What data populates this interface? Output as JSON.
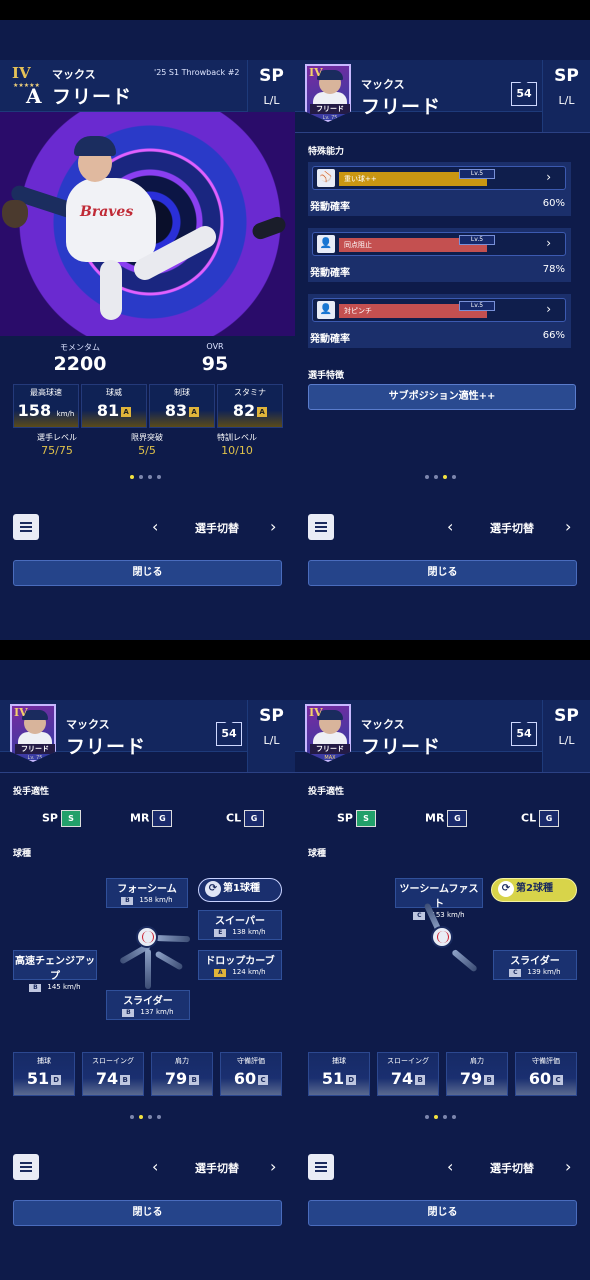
{
  "player": {
    "kana": "マックス",
    "name": "フリード",
    "card_series": "'25 S1 Throwback #2",
    "rank": "IV",
    "team_logo": "A",
    "position": "SP",
    "handedness": "L/L",
    "number": "54",
    "avatar_tag": "フリード",
    "avatar_level_tag": "Lv. 75",
    "avatar_max_tag": "MAX"
  },
  "overview": {
    "momentum_label": "モメンタム",
    "momentum_value": "2200",
    "ovr_label": "OVR",
    "ovr_value": "95",
    "stats": [
      {
        "label": "最高球速",
        "value": "158",
        "unit": "km/h",
        "grade": ""
      },
      {
        "label": "球威",
        "value": "81",
        "unit": "",
        "grade": "A"
      },
      {
        "label": "制球",
        "value": "83",
        "unit": "",
        "grade": "A"
      },
      {
        "label": "スタミナ",
        "value": "82",
        "unit": "",
        "grade": "A"
      }
    ],
    "levels": [
      {
        "label": "選手レベル",
        "value": "75/75"
      },
      {
        "label": "限界突破",
        "value": "5/5"
      },
      {
        "label": "特訓レベル",
        "value": "10/10"
      }
    ]
  },
  "abilities": {
    "title": "特殊能力",
    "items": [
      {
        "name": "重い球++",
        "level": "Lv.5",
        "prob_label": "発動確率",
        "prob": "60%",
        "color": "#c99612"
      },
      {
        "name": "同点阻止",
        "level": "Lv.5",
        "prob_label": "発動確率",
        "prob": "78%",
        "color": "#c45050"
      },
      {
        "name": "対ピンチ",
        "level": "Lv.5",
        "prob_label": "発動確率",
        "prob": "66%",
        "color": "#c45050"
      }
    ],
    "traits_title": "選手特徴",
    "trait_button": "サブポジション適性++"
  },
  "pitching": {
    "aptitude_title": "投手適性",
    "aptitudes": [
      {
        "pos": "SP",
        "grade": "S"
      },
      {
        "pos": "MR",
        "grade": "G"
      },
      {
        "pos": "CL",
        "grade": "G"
      }
    ],
    "pitch_title": "球種",
    "pitches_a": [
      {
        "name": "フォーシーム",
        "grade": "B",
        "speed": "158 km/h"
      },
      {
        "name": "スイーパー",
        "grade": "E",
        "speed": "138 km/h"
      },
      {
        "name": "高速チェンジアップ",
        "grade": "B",
        "speed": "145 km/h"
      },
      {
        "name": "ドロップカーブ",
        "grade": "A",
        "speed": "124 km/h"
      },
      {
        "name": "スライダー",
        "grade": "B",
        "speed": "137 km/h"
      }
    ],
    "first_pitch_badge": "第1球種",
    "pitches_b": [
      {
        "name": "ツーシームファスト",
        "grade": "C",
        "speed": "153 km/h"
      },
      {
        "name": "スライダー",
        "grade": "C",
        "speed": "139 km/h"
      }
    ],
    "second_pitch_badge": "第2球種",
    "fielding": [
      {
        "label": "捕球",
        "value": "51",
        "grade": "D"
      },
      {
        "label": "スローイング",
        "value": "74",
        "grade": "B"
      },
      {
        "label": "肩力",
        "value": "79",
        "grade": "B"
      },
      {
        "label": "守備評価",
        "value": "60",
        "grade": "C"
      }
    ]
  },
  "nav": {
    "switch_label": "選手切替",
    "close_label": "閉じる",
    "prev": "‹",
    "next": "›"
  }
}
